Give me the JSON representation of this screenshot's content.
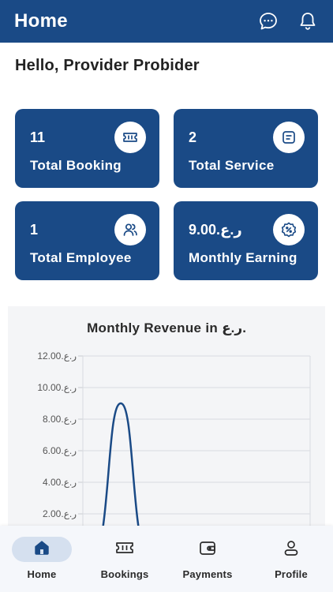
{
  "appbar": {
    "title": "Home",
    "icons": [
      "chat-icon",
      "bell-icon"
    ]
  },
  "greeting": "Hello, Provider Probider",
  "stats": [
    {
      "value": "11",
      "label": "Total Booking",
      "icon": "ticket-icon"
    },
    {
      "value": "2",
      "label": "Total Service",
      "icon": "list-icon"
    },
    {
      "value": "1",
      "label": "Total Employee",
      "icon": "users-icon"
    },
    {
      "value": "9.00.ر.ع",
      "label": "Monthly Earning",
      "icon": "discount-badge-icon"
    }
  ],
  "colors": {
    "primary": "#1a4a86",
    "background": "#ffffff",
    "chart_panel": "#f4f5f7",
    "nav_active_pill": "#d5e0ef"
  },
  "chart_data": {
    "type": "line",
    "title": "Monthly Revenue in ر.ع.",
    "y_tick_labels": [
      "12.00.ر.ع",
      "10.00.ر.ع",
      "8.00.ر.ع",
      "6.00.ر.ع",
      "4.00.ر.ع",
      "2.00.ر.ع"
    ],
    "y_ticks": [
      12,
      10,
      8,
      6,
      4,
      2
    ],
    "ylim": [
      0,
      12
    ],
    "series": [
      {
        "values": [
          0,
          9,
          0
        ]
      }
    ],
    "grid": true,
    "smooth": true
  },
  "bottom_nav": [
    {
      "label": "Home",
      "icon": "home-icon",
      "active": true
    },
    {
      "label": "Bookings",
      "icon": "ticket-icon",
      "active": false
    },
    {
      "label": "Payments",
      "icon": "wallet-icon",
      "active": false
    },
    {
      "label": "Profile",
      "icon": "person-icon",
      "active": false
    }
  ]
}
